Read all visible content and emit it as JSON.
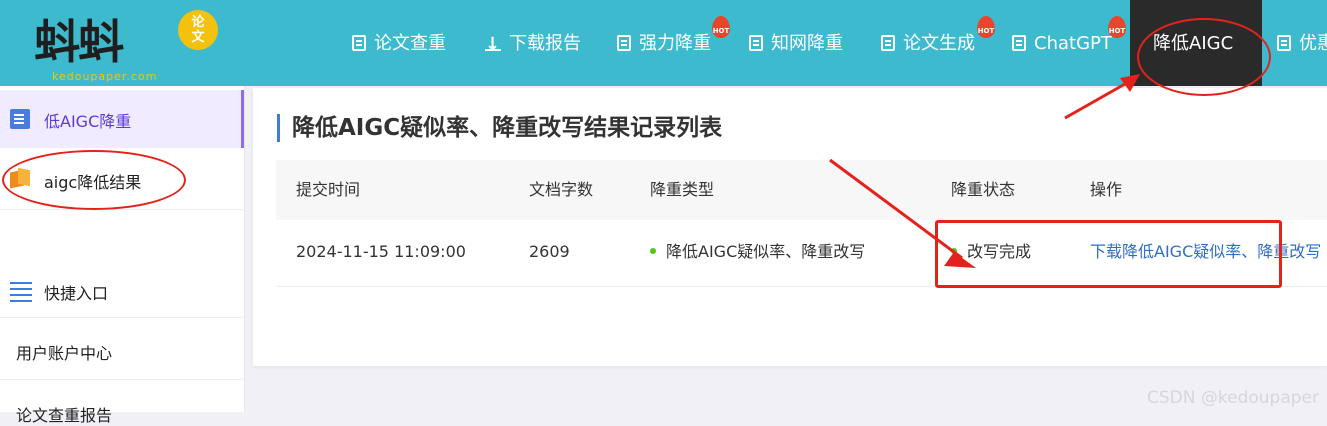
{
  "header": {
    "logo_text": "蚪蚪",
    "logo_badge": [
      "论",
      "文"
    ],
    "logo_domain": "kedoupaper.com",
    "nav": [
      {
        "label": "论文查重",
        "icon": "document-icon",
        "hot": false
      },
      {
        "label": "下载报告",
        "icon": "download-icon",
        "hot": false
      },
      {
        "label": "强力降重",
        "icon": "grid-icon",
        "hot": true
      },
      {
        "label": "知网降重",
        "icon": "document-icon",
        "hot": false
      },
      {
        "label": "论文生成",
        "icon": "document-icon",
        "hot": true
      },
      {
        "label": "ChatGPT",
        "icon": "chat-icon",
        "hot": true
      },
      {
        "label": "降低AIGC",
        "icon": "",
        "hot": false,
        "active": true
      },
      {
        "label": "优惠",
        "icon": "chat-icon",
        "hot": false
      }
    ],
    "hot_label": "HOT",
    "colors": {
      "bar": "#3ebacf",
      "active": "#2b2a2a",
      "hot": "#e8452c",
      "annotation": "#e3231b"
    }
  },
  "sidebar": {
    "items": [
      {
        "label": "低AIGC降重",
        "icon": "document-icon",
        "active": true
      },
      {
        "label": "aigc降低结果",
        "icon": "book-icon"
      },
      {
        "label": "快捷入口",
        "icon": "list-icon"
      },
      {
        "label": "用户账户中心"
      },
      {
        "label": "论文查重报告"
      }
    ]
  },
  "main": {
    "title": "降低AIGC疑似率、降重改写结果记录列表",
    "table": {
      "headers": [
        "提交时间",
        "文档字数",
        "降重类型",
        "降重状态",
        "操作"
      ],
      "rows": [
        {
          "time": "2024-11-15 11:09:00",
          "words": "2609",
          "type": "降低AIGC疑似率、降重改写",
          "status": "改写完成",
          "action": "下载降低AIGC疑似率、降重改写"
        }
      ]
    }
  },
  "watermark": "CSDN @kedoupaper"
}
